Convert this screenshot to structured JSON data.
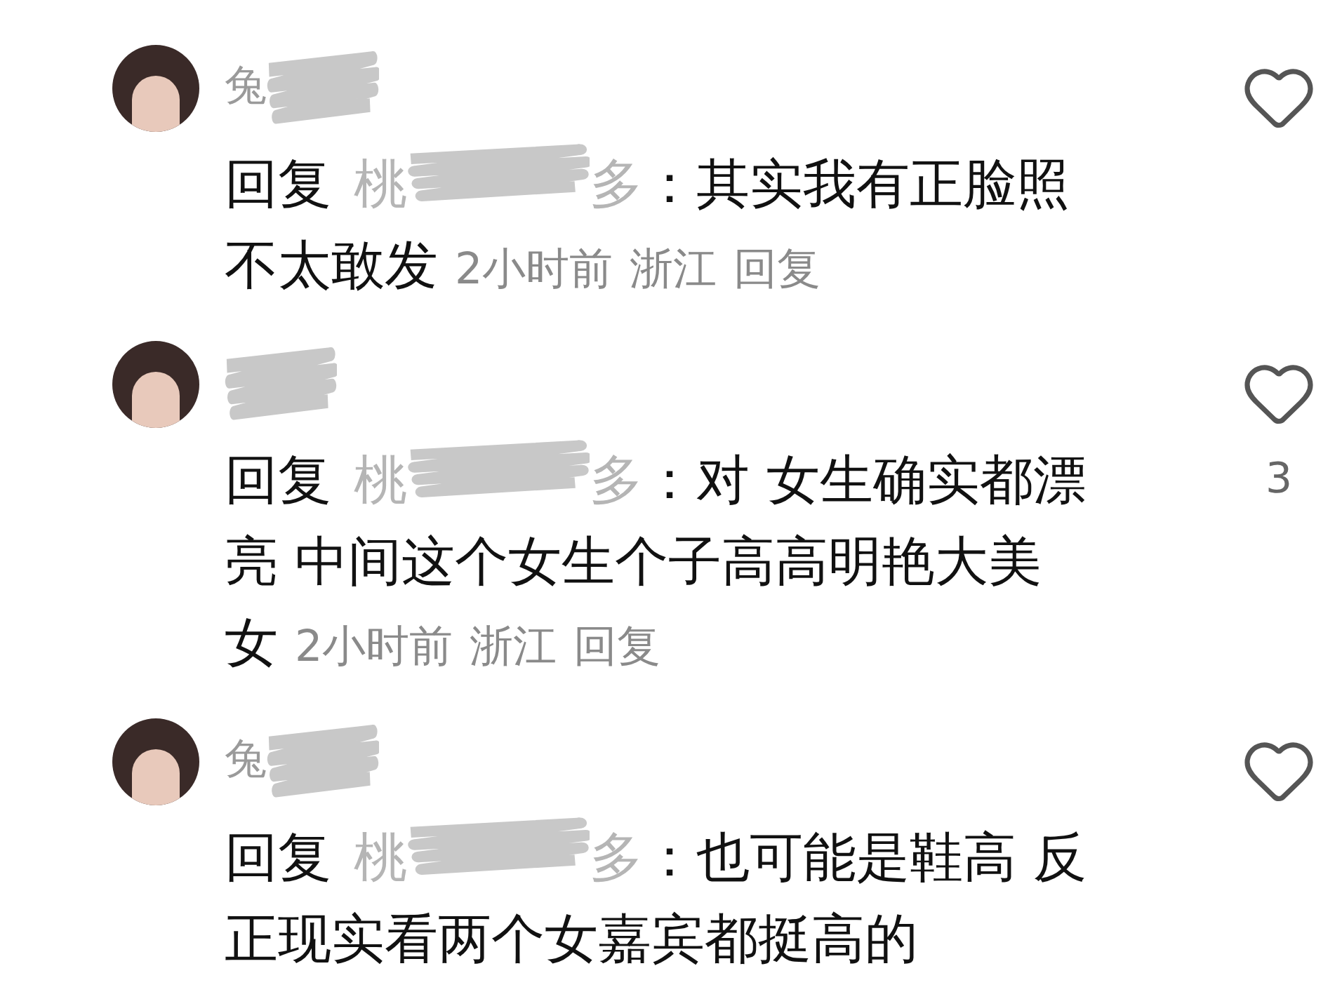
{
  "comments": [
    {
      "username": "兔",
      "reply_label": "回复",
      "target_start": "桃",
      "target_end": "多",
      "text_lines": [
        "：其实我有正脸照",
        "不太敢发"
      ],
      "time": "2小时前",
      "location": "浙江",
      "reply_button": "回复",
      "liked": false
    },
    {
      "reply_label": "回复",
      "target_start": "桃",
      "target_end": "多",
      "text_lines": [
        "：对 女生确实都漂",
        "亮 中间这个女生个子高高明艳大美",
        "女"
      ],
      "time": "2小时前",
      "location": "浙江",
      "reply_button": "回复",
      "liked": false,
      "like_count": "3"
    },
    {
      "username": "兔",
      "reply_label": "回复",
      "target_start": "桃",
      "target_end": "多",
      "text_lines": [
        "：也可能是鞋高 反",
        "正现实看两个女嘉宾都挺高的"
      ],
      "liked": false
    }
  ]
}
